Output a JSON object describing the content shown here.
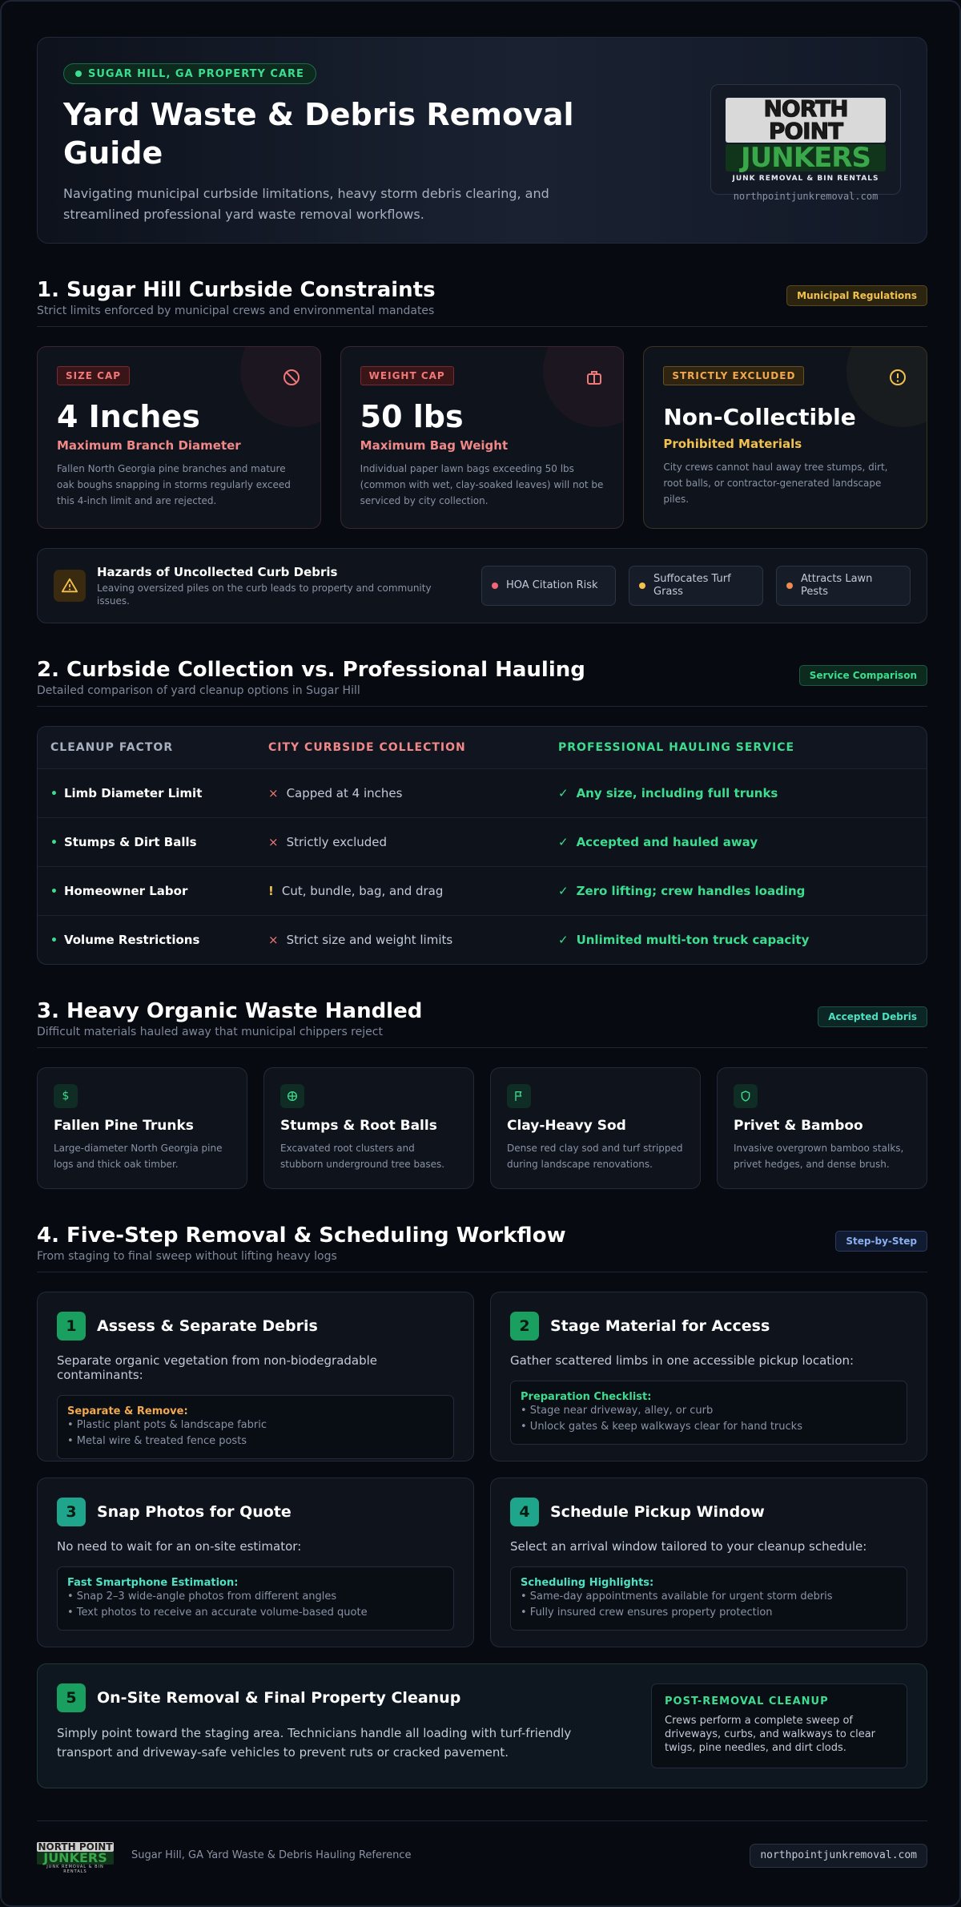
{
  "hero": {
    "badge": "SUGAR HILL, GA PROPERTY CARE",
    "title": "Yard Waste & Debris Removal Guide",
    "subtitle": "Navigating municipal curbside limitations, heavy storm debris clearing, and streamlined professional yard waste removal workflows.",
    "logo_top": "NORTH POINT",
    "logo_main": "JUNKERS",
    "logo_tagline": "JUNK REMOVAL & BIN RENTALS",
    "logo_url": "northpointjunkremoval.com"
  },
  "section1": {
    "title": "1. Sugar Hill Curbside Constraints",
    "subtitle": "Strict limits enforced by municipal crews and environmental mandates",
    "tag": "Municipal Regulations",
    "cards": [
      {
        "label": "SIZE CAP",
        "value": "4 Inches",
        "caption": "Maximum Branch Diameter",
        "desc": "Fallen North Georgia pine branches and mature oak boughs snapping in storms regularly exceed this 4-inch limit and are rejected.",
        "icon": "prohibited-icon"
      },
      {
        "label": "WEIGHT CAP",
        "value": "50 lbs",
        "caption": "Maximum Bag Weight",
        "desc": "Individual paper lawn bags exceeding 50 lbs (common with wet, clay-soaked leaves) will not be serviced by city collection.",
        "icon": "bag-icon"
      },
      {
        "label": "STRICTLY EXCLUDED",
        "value": "Non-Collectible",
        "caption": "Prohibited Materials",
        "desc": "City crews cannot haul away tree stumps, dirt, root balls, or contractor-generated landscape piles.",
        "icon": "alert-circle-icon"
      }
    ],
    "hazard": {
      "title": "Hazards of Uncollected Curb Debris",
      "subtitle": "Leaving oversized piles on the curb leads to property and community issues.",
      "chips": [
        "HOA Citation Risk",
        "Suffocates Turf Grass",
        "Attracts Lawn Pests"
      ]
    }
  },
  "section2": {
    "title": "2. Curbside Collection vs. Professional Hauling",
    "subtitle": "Detailed comparison of yard cleanup options in Sugar Hill",
    "tag": "Service Comparison",
    "headers": [
      "CLEANUP FACTOR",
      "CITY CURBSIDE COLLECTION",
      "PROFESSIONAL HAULING SERVICE"
    ],
    "rows": [
      {
        "factor": "Limb Diameter Limit",
        "city_mark": "×",
        "city": "Capped at 4 inches",
        "pro": "Any size, including full trunks"
      },
      {
        "factor": "Stumps & Dirt Balls",
        "city_mark": "×",
        "city": "Strictly excluded",
        "pro": "Accepted and hauled away"
      },
      {
        "factor": "Homeowner Labor",
        "city_mark": "!",
        "city": "Cut, bundle, bag, and drag",
        "pro": "Zero lifting; crew handles loading"
      },
      {
        "factor": "Volume Restrictions",
        "city_mark": "×",
        "city": "Strict size and weight limits",
        "pro": "Unlimited multi-ton truck capacity"
      }
    ],
    "check_mark": "✓",
    "bullet": "•"
  },
  "section3": {
    "title": "3. Heavy Organic Waste Handled",
    "subtitle": "Difficult materials hauled away that municipal chippers reject",
    "tag": "Accepted Debris",
    "cards": [
      {
        "title": "Fallen Pine Trunks",
        "desc": "Large-diameter North Georgia pine logs and thick oak timber.",
        "icon": "dollar-icon"
      },
      {
        "title": "Stumps & Root Balls",
        "desc": "Excavated root clusters and stubborn underground tree bases.",
        "icon": "crosshair-icon"
      },
      {
        "title": "Clay-Heavy Sod",
        "desc": "Dense red clay sod and turf stripped during landscape renovations.",
        "icon": "flag-icon"
      },
      {
        "title": "Privet & Bamboo",
        "desc": "Invasive overgrown bamboo stalks, privet hedges, and dense brush.",
        "icon": "shield-icon"
      }
    ]
  },
  "section4": {
    "title": "4. Five-Step Removal & Scheduling Workflow",
    "subtitle": "From staging to final sweep without lifting heavy logs",
    "tag": "Step-by-Step",
    "steps": [
      {
        "num": "1",
        "title": "Assess & Separate Debris",
        "intro": "Separate organic vegetation from non-biodegradable contaminants:",
        "box_title": "Separate & Remove:",
        "items": [
          "• Plastic plant pots & landscape fabric",
          "• Metal wire & treated fence posts"
        ]
      },
      {
        "num": "2",
        "title": "Stage Material for Access",
        "intro": "Gather scattered limbs in one accessible pickup location:",
        "box_title": "Preparation Checklist:",
        "items": [
          "• Stage near driveway, alley, or curb",
          "• Unlock gates & keep walkways clear for hand trucks"
        ]
      },
      {
        "num": "3",
        "title": "Snap Photos for Quote",
        "intro": "No need to wait for an on-site estimator:",
        "box_title": "Fast Smartphone Estimation:",
        "items": [
          "• Snap 2–3 wide-angle photos from different angles",
          "• Text photos to receive an accurate volume-based quote"
        ]
      },
      {
        "num": "4",
        "title": "Schedule Pickup Window",
        "intro": "Select an arrival window tailored to your cleanup schedule:",
        "box_title": "Scheduling Highlights:",
        "items": [
          "• Same-day appointments available for urgent storm debris",
          "• Fully insured crew ensures property protection"
        ]
      }
    ],
    "step5": {
      "num": "5",
      "title": "On-Site Removal & Final Property Cleanup",
      "body": "Simply point toward the staging area. Technicians handle all loading with turf-friendly transport and driveway-safe vehicles to prevent ruts or cracked pavement.",
      "box_title": "POST-REMOVAL CLEANUP",
      "box_text": "Crews perform a complete sweep of driveways, curbs, and walkways to clear twigs, pine needles, and dirt clods."
    }
  },
  "footer": {
    "logo_top": "NORTH POINT",
    "logo_main": "JUNKERS",
    "logo_tagline": "JUNK REMOVAL & BIN RENTALS",
    "text": "Sugar Hill, GA Yard Waste & Debris Hauling Reference",
    "url": "northpointjunkremoval.com"
  },
  "colors": {
    "green": "#3ddc8f",
    "red": "#f07878",
    "amber": "#f2c14e",
    "teal": "#1fa58b"
  }
}
